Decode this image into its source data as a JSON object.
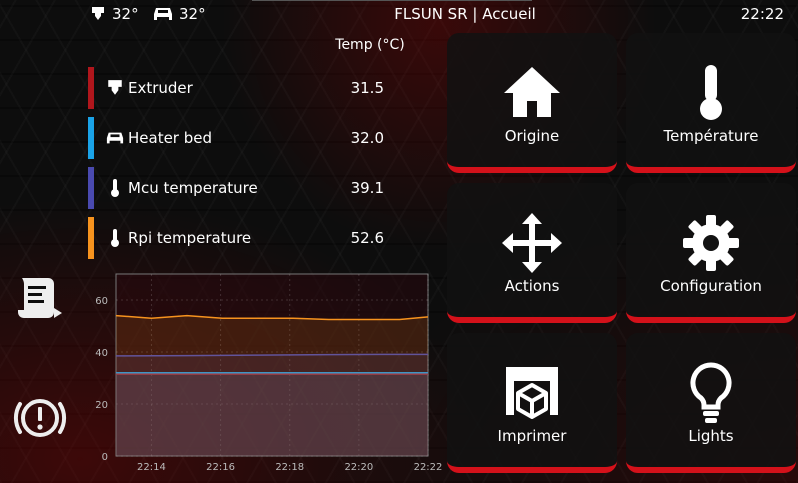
{
  "topbar": {
    "extruder_temp": "32°",
    "bed_temp": "32°",
    "title": "FLSUN SR | Accueil",
    "time": "22:22"
  },
  "temperatures": {
    "header": "Temp (°C)",
    "rows": [
      {
        "name": "Extruder",
        "value": "31.5",
        "color": "#b0161c",
        "icon": "extruder-icon"
      },
      {
        "name": "Heater bed",
        "value": "32.0",
        "color": "#1aa3e8",
        "icon": "bed-icon"
      },
      {
        "name": "Mcu temperature",
        "value": "39.1",
        "color": "#4a4ab0",
        "icon": "thermometer-icon"
      },
      {
        "name": "Rpi temperature",
        "value": "52.6",
        "color": "#f7931e",
        "icon": "thermometer-icon"
      }
    ]
  },
  "side_buttons": [
    {
      "name": "gcode-console-button",
      "icon": "script-icon"
    },
    {
      "name": "emergency-stop-button",
      "icon": "alert-circle-icon"
    }
  ],
  "tiles": [
    {
      "label": "Origine",
      "icon": "home-icon"
    },
    {
      "label": "Température",
      "icon": "thermometer-icon"
    },
    {
      "label": "Actions",
      "icon": "move-arrows-icon"
    },
    {
      "label": "Configuration",
      "icon": "gear-icon"
    },
    {
      "label": "Imprimer",
      "icon": "printer-icon"
    },
    {
      "label": "Lights",
      "icon": "lightbulb-icon"
    }
  ],
  "chart_data": {
    "type": "line",
    "x_ticks": [
      "22:14",
      "22:16",
      "22:18",
      "22:20",
      "22:22"
    ],
    "y_ticks": [
      "0",
      "20",
      "40",
      "60"
    ],
    "ylim": [
      0,
      70
    ],
    "xlim": [
      0,
      8.8
    ],
    "grid": true,
    "series": [
      {
        "name": "Rpi temperature",
        "color": "#f7931e",
        "x": [
          0,
          1,
          2,
          3,
          4,
          5,
          6,
          7,
          8,
          8.8
        ],
        "values": [
          54,
          53,
          54,
          53,
          53,
          53,
          52.5,
          52.5,
          52.5,
          53.5
        ]
      },
      {
        "name": "Mcu temperature",
        "color": "#4a4ab0",
        "x": [
          0,
          2,
          4,
          6,
          8,
          8.8
        ],
        "values": [
          38.5,
          38.6,
          38.8,
          39.0,
          39.1,
          39.1
        ]
      },
      {
        "name": "Heater bed",
        "color": "#1aa3e8",
        "x": [
          0,
          4,
          8.8
        ],
        "values": [
          32,
          32,
          32
        ]
      },
      {
        "name": "Extruder",
        "color": "#b0161c",
        "x": [
          0,
          4,
          8.8
        ],
        "values": [
          31.5,
          31.5,
          31.5
        ]
      }
    ]
  }
}
